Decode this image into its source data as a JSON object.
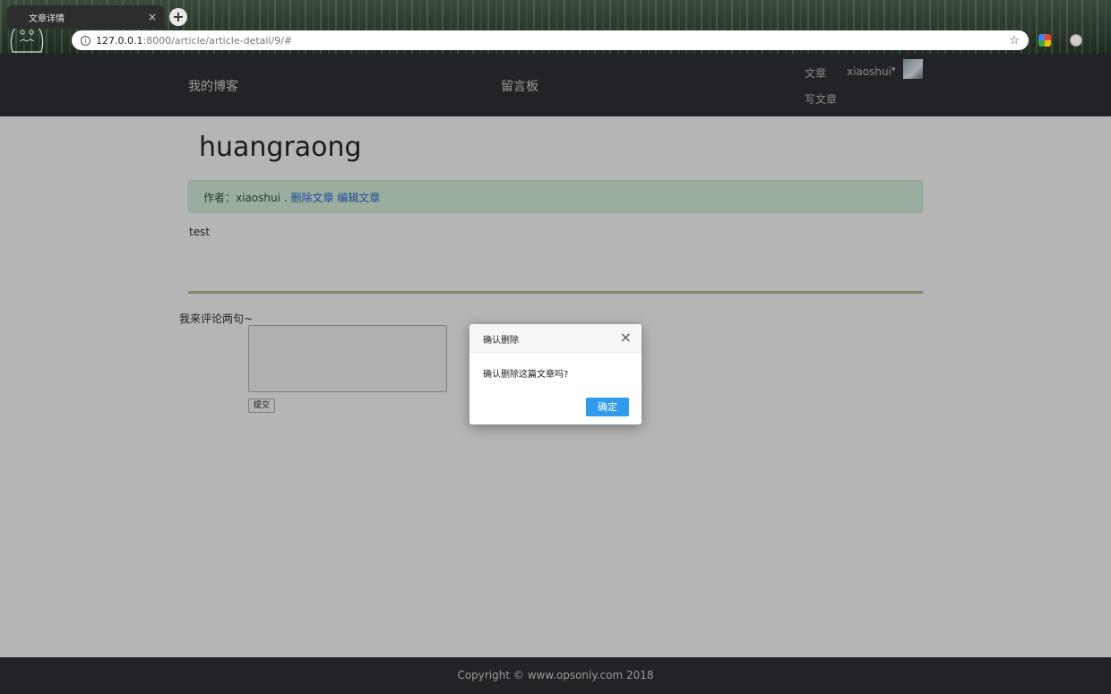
{
  "browser": {
    "tab_title": "文章详情",
    "tab_close": "×",
    "new_tab": "+",
    "url_host": "127.0.0.1",
    "url_path": ":8000/article/article-detail/9/#",
    "info_glyph": "i",
    "star_glyph": "☆",
    "icons": [
      "totoro-icon",
      "info-icon",
      "star-icon",
      "extension-icon",
      "profile-icon"
    ]
  },
  "navbar": {
    "brand": "我的博客",
    "guestbook": "留言板",
    "article": "文章",
    "user": "xiaoshui",
    "caret": "▾",
    "write": "写文章"
  },
  "article": {
    "title": "huangraong",
    "author_prefix": "作者：",
    "author_name": "xiaoshui",
    "author_sep": ".",
    "delete_link": "删除文章",
    "edit_link": "编辑文章",
    "body": "test"
  },
  "comment": {
    "label": "我来评论两句~",
    "value": "",
    "submit": "提交"
  },
  "modal": {
    "title": "确认删除",
    "close": "×",
    "message": "确认删除这篇文章吗?",
    "ok": "确定"
  },
  "footer": {
    "text": "Copyright © www.opsonly.com 2018"
  },
  "colors": {
    "navbar_bg": "#212326",
    "overlay_bg": "#b5b5b5",
    "author_bar_bg": "#9bad9f",
    "primary_button": "#2f9bea",
    "link": "#1a4d9a"
  }
}
